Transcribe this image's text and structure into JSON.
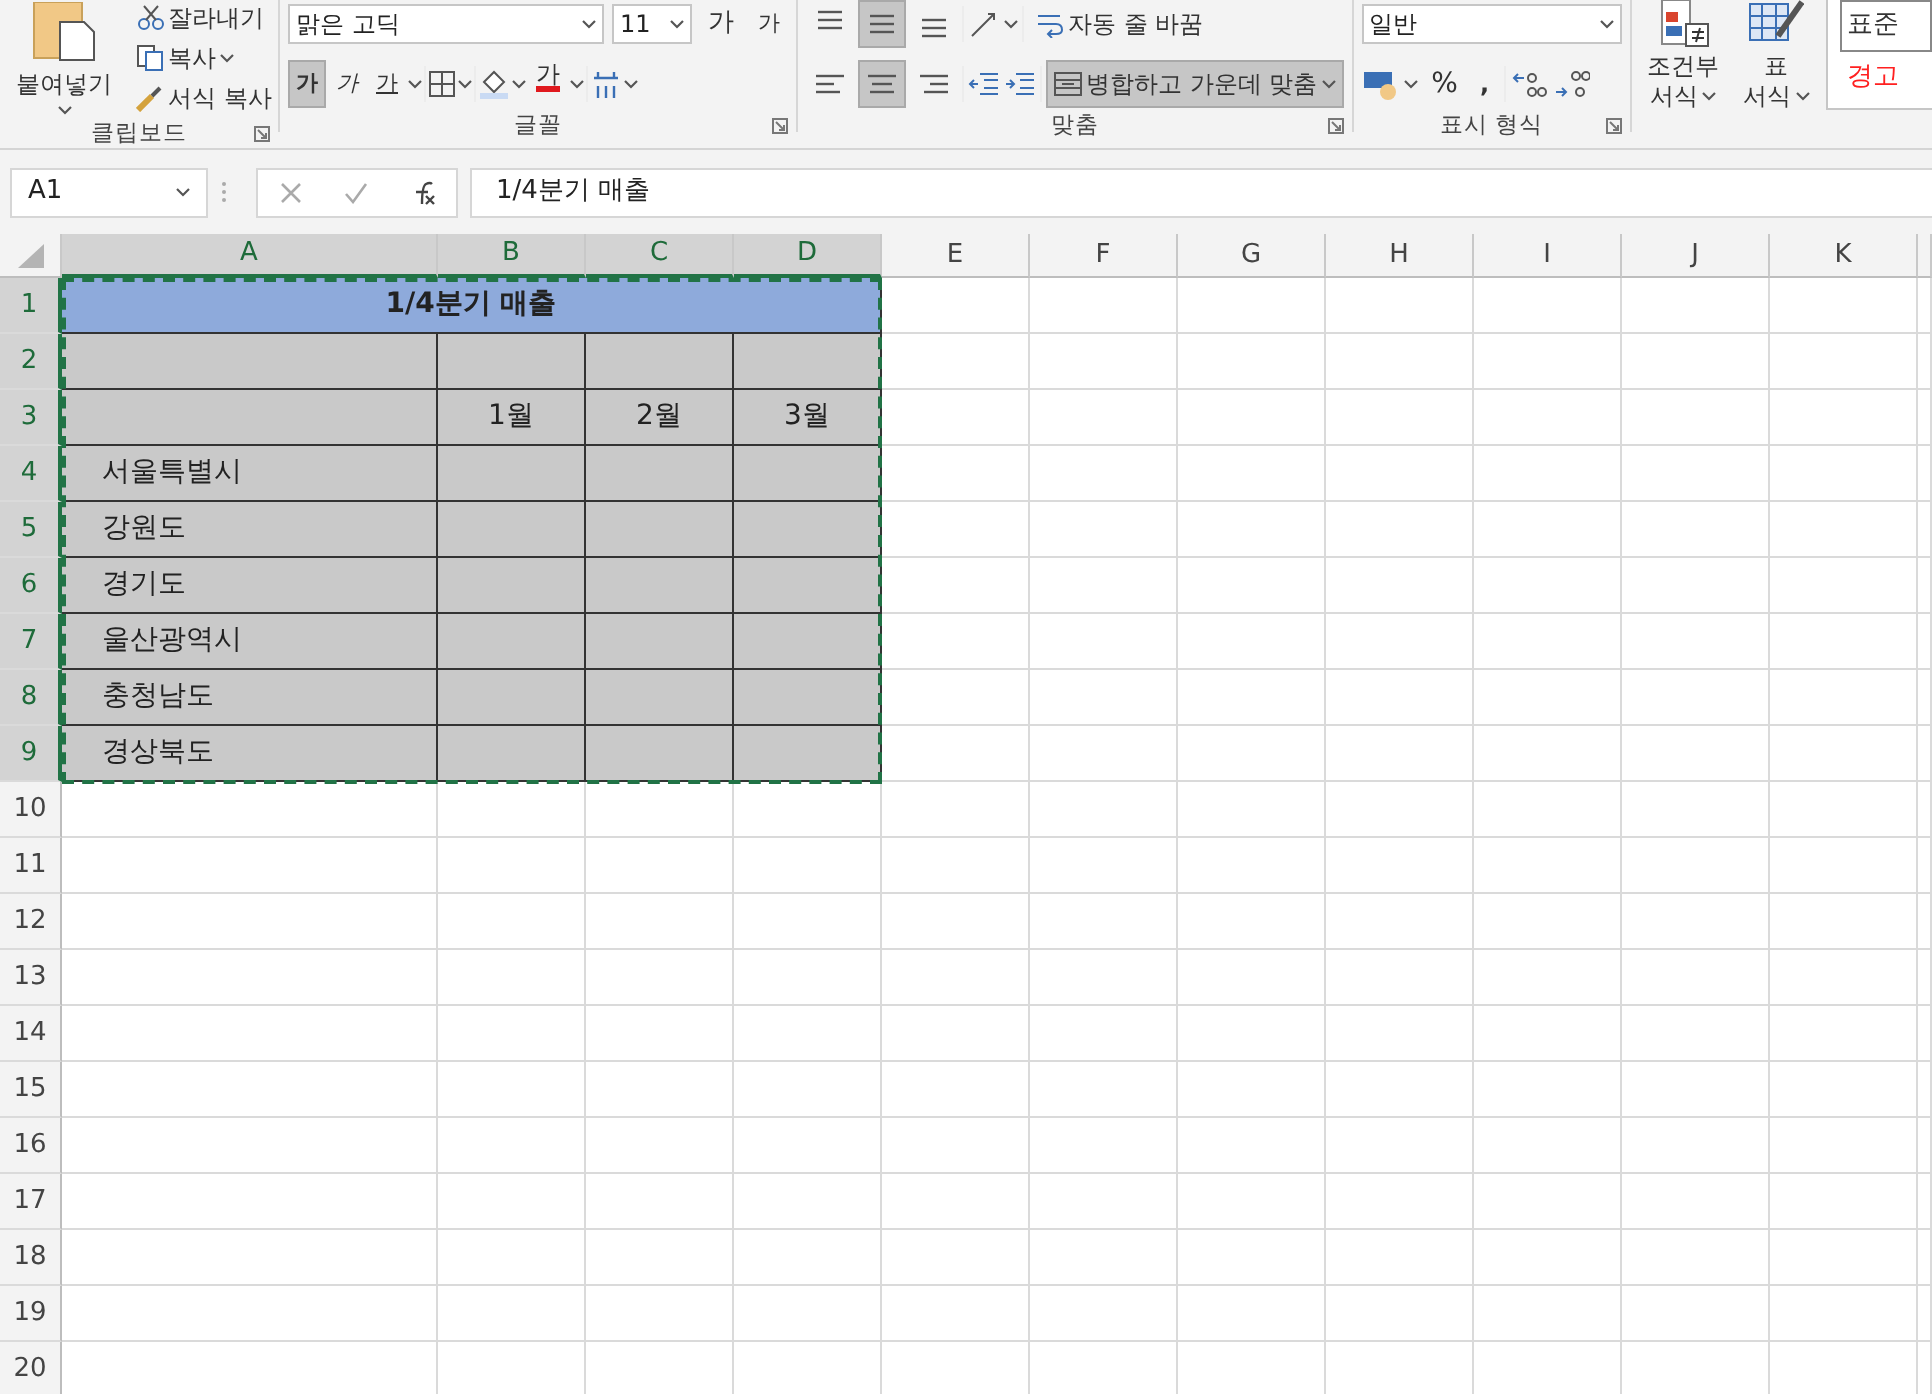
{
  "ribbon": {
    "clipboard": {
      "label": "클립보드",
      "paste": "붙여넣기",
      "actions": [
        {
          "kind": "cut",
          "label": "잘라내기"
        },
        {
          "kind": "copy",
          "label": "복사"
        },
        {
          "kind": "painter",
          "label": "서식 복사"
        }
      ]
    },
    "font": {
      "label": "글꼴",
      "font_name": "맑은 고딕",
      "font_size": "11",
      "size_buttons": [
        "가",
        "가"
      ],
      "style_buttons": [
        {
          "kind": "bold",
          "label": "가",
          "selected": true
        },
        {
          "kind": "italic",
          "label": "가",
          "selected": false
        },
        {
          "kind": "underline",
          "label": "가",
          "selected": false
        }
      ],
      "font_color_label": "가"
    },
    "alignment": {
      "label": "맞춤",
      "vertical": [
        {
          "kind": "top",
          "selected": false
        },
        {
          "kind": "middle",
          "selected": true
        },
        {
          "kind": "bottom",
          "selected": false
        }
      ],
      "horizontal": [
        {
          "kind": "left",
          "selected": false
        },
        {
          "kind": "center",
          "selected": true
        },
        {
          "kind": "right",
          "selected": false
        }
      ],
      "wrap_text": "자동 줄 바꿈",
      "merge_center": {
        "label": "병합하고 가운데 맞춤",
        "selected": true
      }
    },
    "number": {
      "label": "표시 형식",
      "format": "일반",
      "percent": "%",
      "comma": ","
    },
    "styles": {
      "conditional": [
        "조건부",
        "서식"
      ],
      "table": [
        "표",
        "서식"
      ],
      "cell_styles": [
        {
          "kind": "normal",
          "label": "표준"
        },
        {
          "kind": "warning",
          "label": "경고"
        }
      ]
    }
  },
  "formula_bar": {
    "name_box": "A1",
    "formula": "1/4분기 매출"
  },
  "sheet": {
    "columns": [
      {
        "label": "A",
        "selected": true
      },
      {
        "label": "B",
        "selected": true
      },
      {
        "label": "C",
        "selected": true
      },
      {
        "label": "D",
        "selected": true
      },
      {
        "label": "E",
        "selected": false
      },
      {
        "label": "F",
        "selected": false
      },
      {
        "label": "G",
        "selected": false
      },
      {
        "label": "H",
        "selected": false
      },
      {
        "label": "I",
        "selected": false
      },
      {
        "label": "J",
        "selected": false
      },
      {
        "label": "K",
        "selected": false
      }
    ],
    "rows": [
      {
        "label": "1",
        "selected": true
      },
      {
        "label": "2",
        "selected": true
      },
      {
        "label": "3",
        "selected": true
      },
      {
        "label": "4",
        "selected": true
      },
      {
        "label": "5",
        "selected": true
      },
      {
        "label": "6",
        "selected": true
      },
      {
        "label": "7",
        "selected": true
      },
      {
        "label": "8",
        "selected": true
      },
      {
        "label": "9",
        "selected": true
      },
      {
        "label": "10",
        "selected": false
      },
      {
        "label": "11",
        "selected": false
      },
      {
        "label": "12",
        "selected": false
      },
      {
        "label": "13",
        "selected": false
      },
      {
        "label": "14",
        "selected": false
      },
      {
        "label": "15",
        "selected": false
      },
      {
        "label": "16",
        "selected": false
      },
      {
        "label": "17",
        "selected": false
      },
      {
        "label": "18",
        "selected": false
      },
      {
        "label": "19",
        "selected": false
      },
      {
        "label": "20",
        "selected": false
      }
    ],
    "table": {
      "title": "1/4분기 매출",
      "months": [
        "1월",
        "2월",
        "3월"
      ],
      "regions": [
        "서울특별시",
        "강원도",
        "경기도",
        "울산광역시",
        "충청남도",
        "경상북도"
      ]
    },
    "copy_marquee": true
  }
}
